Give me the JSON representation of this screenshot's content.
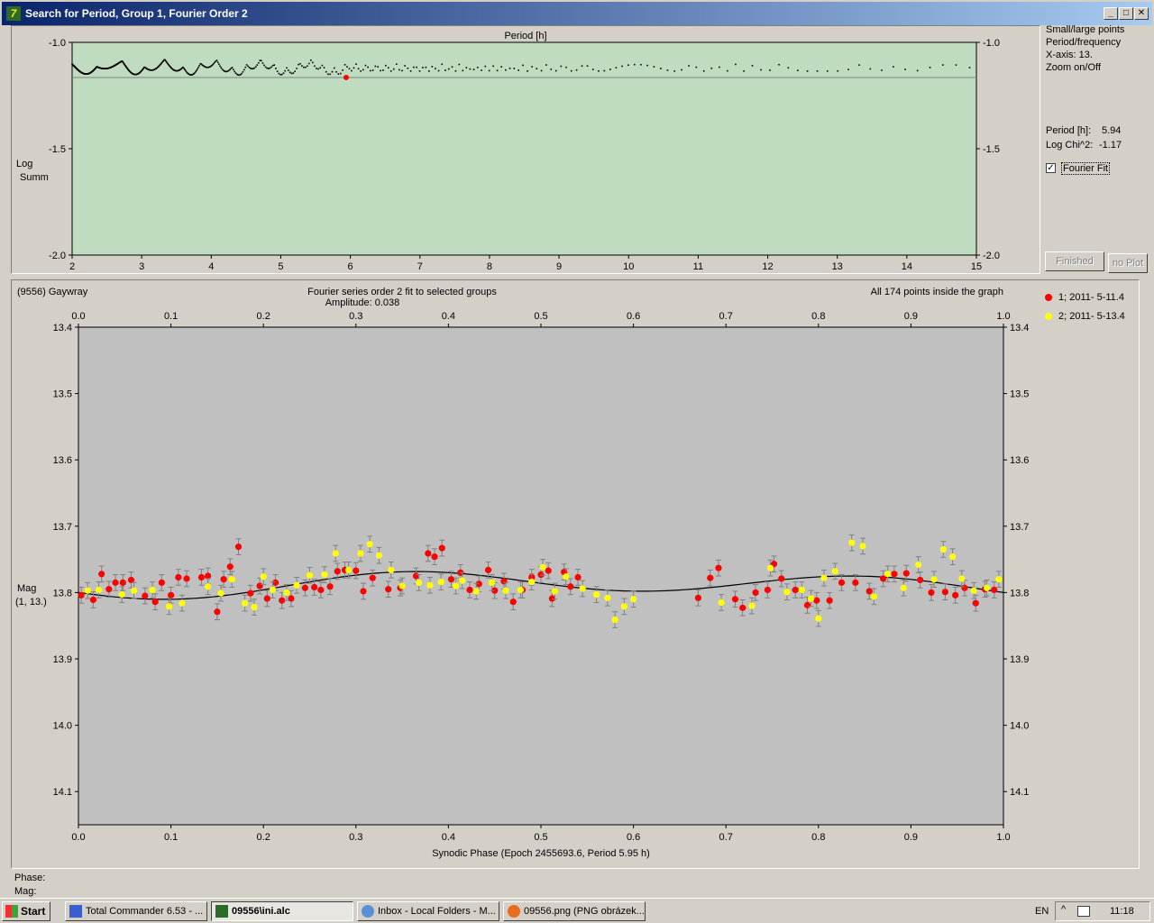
{
  "window": {
    "title": "Search for Period, Group 1, Fourier Order 2"
  },
  "period_panel": {
    "x_title": "Period [h]",
    "y_label_line1": "Log",
    "y_label_line2": "Summ",
    "side_options": [
      "Small/large points",
      "Period/frequency",
      "X-axis: 13.",
      "Zoom on/Off"
    ],
    "period_label": "Period [h]:",
    "period_value": "5.94",
    "logchi_label": "Log Chi^2:",
    "logchi_value": "-1.17",
    "fourier_fit_label": "Fourier Fit",
    "fourier_fit_checked": "✓",
    "finished_label": "Finished",
    "noplot_label": "no Plot"
  },
  "light_panel": {
    "object": "(9556) Gaywray",
    "fit_title": "Fourier series order 2 fit to selected groups",
    "amplitude": "Amplitude: 0.038",
    "points_info": "All 174 points inside the graph",
    "x_title": "Synodic Phase (Epoch 2455693.6, Period 5.95 h)",
    "y_label_line1": "Mag",
    "y_label_line2": "(1, 13.)",
    "legend": [
      {
        "label": "1; 2011- 5-11.4",
        "color": "#ff0000"
      },
      {
        "label": "2; 2011- 5-13.4",
        "color": "#ffff00"
      }
    ]
  },
  "status": {
    "phase_label": "Phase:",
    "mag_label": "Mag:"
  },
  "taskbar": {
    "start_label": "Start",
    "tasks": [
      "Total Commander 6.53 - ...",
      "09556\\ini.alc",
      "Inbox - Local Folders - M...",
      "09556.png (PNG obrázek..."
    ],
    "lang": "EN",
    "clock": "11:18"
  },
  "colors": {
    "periodogram_bg": "#c0dcc0",
    "lightcurve_bg": "#c0c0c0",
    "group1": "#ff0000",
    "group2": "#ffff00",
    "title_gradient_start": "#0a246a"
  },
  "chart_data": [
    {
      "type": "scatter",
      "name": "periodogram",
      "xlabel": "Period [h]",
      "ylabel": "Log Summ",
      "xlim": [
        2,
        15
      ],
      "ylim": [
        -2.0,
        -1.0
      ],
      "xticks": [
        "2",
        "3",
        "4",
        "5",
        "6",
        "7",
        "8",
        "9",
        "10",
        "11",
        "12",
        "13",
        "14",
        "15"
      ],
      "yticks": [
        "-1.0",
        "-1.5",
        "-2.0"
      ],
      "best_period": {
        "x": 5.94,
        "y": -1.165
      },
      "reference_level": -1.165
    },
    {
      "type": "scatter",
      "name": "lightcurve",
      "xlabel": "Synodic Phase (Epoch 2455693.6, Period 5.95 h)",
      "ylabel": "Mag (1, 13.)",
      "xlim": [
        0.0,
        1.0
      ],
      "ylim": [
        13.4,
        14.15
      ],
      "xticks": [
        "0.0",
        "0.1",
        "0.2",
        "0.3",
        "0.4",
        "0.5",
        "0.6",
        "0.7",
        "0.8",
        "0.9",
        "1.0"
      ],
      "yticks": [
        "13.4",
        "13.5",
        "13.6",
        "13.7",
        "13.8",
        "13.9",
        "14.0",
        "14.1"
      ],
      "series": [
        {
          "name": "1; 2011- 5-11.4",
          "color": "#ff0000",
          "points": [
            [
              0.003,
              13.804
            ],
            [
              0.016,
              13.811
            ],
            [
              0.025,
              13.772
            ],
            [
              0.033,
              13.795
            ],
            [
              0.04,
              13.785
            ],
            [
              0.048,
              13.785
            ],
            [
              0.057,
              13.781
            ],
            [
              0.072,
              13.805
            ],
            [
              0.083,
              13.814
            ],
            [
              0.09,
              13.785
            ],
            [
              0.1,
              13.804
            ],
            [
              0.108,
              13.777
            ],
            [
              0.117,
              13.779
            ],
            [
              0.133,
              13.777
            ],
            [
              0.14,
              13.775
            ],
            [
              0.15,
              13.829
            ],
            [
              0.157,
              13.78
            ],
            [
              0.164,
              13.761
            ],
            [
              0.173,
              13.731
            ],
            [
              0.186,
              13.801
            ],
            [
              0.196,
              13.79
            ],
            [
              0.204,
              13.809
            ],
            [
              0.213,
              13.785
            ],
            [
              0.22,
              13.812
            ],
            [
              0.23,
              13.809
            ],
            [
              0.245,
              13.793
            ],
            [
              0.255,
              13.792
            ],
            [
              0.262,
              13.796
            ],
            [
              0.272,
              13.791
            ],
            [
              0.28,
              13.768
            ],
            [
              0.288,
              13.766
            ],
            [
              0.3,
              13.767
            ],
            [
              0.308,
              13.798
            ],
            [
              0.318,
              13.778
            ],
            [
              0.335,
              13.795
            ],
            [
              0.348,
              13.793
            ],
            [
              0.365,
              13.775
            ],
            [
              0.378,
              13.741
            ],
            [
              0.385,
              13.746
            ],
            [
              0.393,
              13.733
            ],
            [
              0.403,
              13.78
            ],
            [
              0.413,
              13.77
            ],
            [
              0.423,
              13.796
            ],
            [
              0.433,
              13.787
            ],
            [
              0.443,
              13.766
            ],
            [
              0.45,
              13.797
            ],
            [
              0.46,
              13.783
            ],
            [
              0.47,
              13.814
            ],
            [
              0.48,
              13.796
            ],
            [
              0.49,
              13.777
            ],
            [
              0.5,
              13.773
            ],
            [
              0.508,
              13.767
            ],
            [
              0.512,
              13.809
            ],
            [
              0.525,
              13.769
            ],
            [
              0.532,
              13.791
            ],
            [
              0.54,
              13.777
            ],
            [
              0.67,
              13.808
            ],
            [
              0.683,
              13.778
            ],
            [
              0.692,
              13.763
            ],
            [
              0.71,
              13.81
            ],
            [
              0.718,
              13.823
            ],
            [
              0.732,
              13.8
            ],
            [
              0.745,
              13.796
            ],
            [
              0.752,
              13.757
            ],
            [
              0.76,
              13.779
            ],
            [
              0.775,
              13.796
            ],
            [
              0.788,
              13.819
            ],
            [
              0.798,
              13.812
            ],
            [
              0.812,
              13.812
            ],
            [
              0.825,
              13.785
            ],
            [
              0.84,
              13.785
            ],
            [
              0.855,
              13.798
            ],
            [
              0.87,
              13.779
            ],
            [
              0.882,
              13.772
            ],
            [
              0.895,
              13.771
            ],
            [
              0.91,
              13.781
            ],
            [
              0.922,
              13.8
            ],
            [
              0.937,
              13.799
            ],
            [
              0.948,
              13.804
            ],
            [
              0.958,
              13.793
            ],
            [
              0.97,
              13.816
            ],
            [
              0.98,
              13.795
            ],
            [
              0.99,
              13.796
            ]
          ]
        },
        {
          "name": "2; 2011- 5-13.4",
          "color": "#ffff00",
          "points": [
            [
              0.01,
              13.797
            ],
            [
              0.022,
              13.796
            ],
            [
              0.047,
              13.803
            ],
            [
              0.06,
              13.797
            ],
            [
              0.08,
              13.796
            ],
            [
              0.098,
              13.821
            ],
            [
              0.112,
              13.816
            ],
            [
              0.14,
              13.791
            ],
            [
              0.154,
              13.801
            ],
            [
              0.166,
              13.78
            ],
            [
              0.18,
              13.816
            ],
            [
              0.19,
              13.822
            ],
            [
              0.2,
              13.776
            ],
            [
              0.21,
              13.796
            ],
            [
              0.225,
              13.8
            ],
            [
              0.236,
              13.789
            ],
            [
              0.25,
              13.774
            ],
            [
              0.266,
              13.773
            ],
            [
              0.278,
              13.741
            ],
            [
              0.292,
              13.766
            ],
            [
              0.305,
              13.741
            ],
            [
              0.315,
              13.727
            ],
            [
              0.325,
              13.744
            ],
            [
              0.338,
              13.766
            ],
            [
              0.35,
              13.79
            ],
            [
              0.368,
              13.785
            ],
            [
              0.38,
              13.789
            ],
            [
              0.392,
              13.784
            ],
            [
              0.408,
              13.79
            ],
            [
              0.415,
              13.782
            ],
            [
              0.43,
              13.798
            ],
            [
              0.447,
              13.785
            ],
            [
              0.462,
              13.797
            ],
            [
              0.478,
              13.796
            ],
            [
              0.49,
              13.784
            ],
            [
              0.502,
              13.762
            ],
            [
              0.515,
              13.798
            ],
            [
              0.527,
              13.776
            ],
            [
              0.545,
              13.794
            ],
            [
              0.56,
              13.803
            ],
            [
              0.572,
              13.808
            ],
            [
              0.58,
              13.841
            ],
            [
              0.59,
              13.821
            ],
            [
              0.6,
              13.81
            ],
            [
              0.695,
              13.815
            ],
            [
              0.728,
              13.82
            ],
            [
              0.748,
              13.763
            ],
            [
              0.766,
              13.799
            ],
            [
              0.782,
              13.796
            ],
            [
              0.792,
              13.809
            ],
            [
              0.8,
              13.839
            ],
            [
              0.806,
              13.778
            ],
            [
              0.818,
              13.768
            ],
            [
              0.836,
              13.725
            ],
            [
              0.848,
              13.73
            ],
            [
              0.86,
              13.806
            ],
            [
              0.875,
              13.772
            ],
            [
              0.892,
              13.793
            ],
            [
              0.908,
              13.758
            ],
            [
              0.925,
              13.78
            ],
            [
              0.935,
              13.735
            ],
            [
              0.945,
              13.746
            ],
            [
              0.955,
              13.779
            ],
            [
              0.968,
              13.797
            ],
            [
              0.982,
              13.793
            ],
            [
              0.995,
              13.78
            ]
          ]
        }
      ]
    }
  ]
}
